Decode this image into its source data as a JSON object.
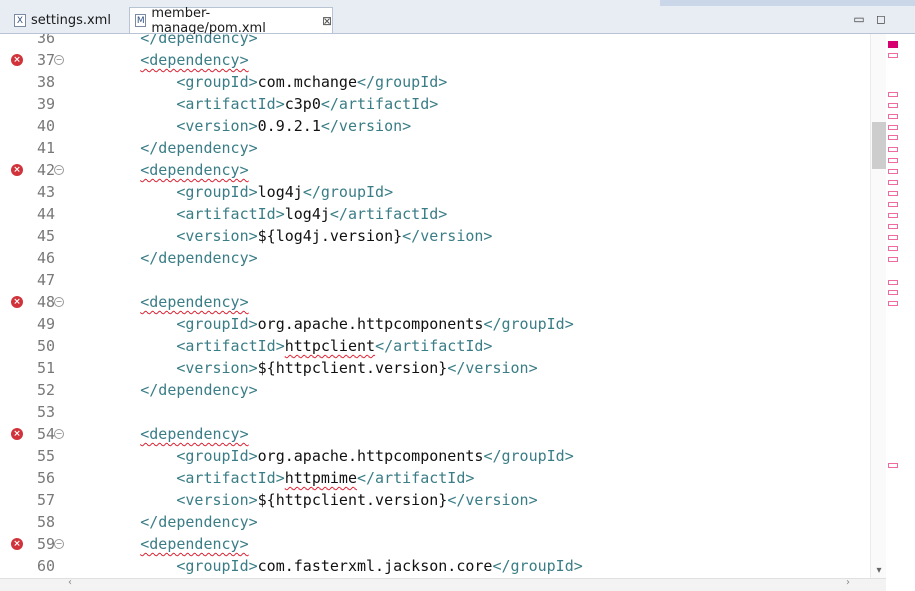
{
  "tabs": [
    {
      "label": "settings.xml",
      "icon": "xml-file-icon",
      "icon_glyph": "X",
      "active": false
    },
    {
      "label": "member-manage/pom.xml",
      "icon": "maven-pom-icon",
      "icon_glyph": "M",
      "active": true,
      "close": "⊠"
    }
  ],
  "window": {
    "minimize": "▭",
    "maximize": "◻"
  },
  "colors": {
    "tag": "#3a7d86",
    "error": "#d0343a",
    "marker": "#ee6aa0",
    "text": "#111111"
  },
  "editor": {
    "lines": [
      {
        "num": "36",
        "indent": "        ",
        "tokens": [
          {
            "t": "t",
            "v": "</dependency>"
          }
        ]
      },
      {
        "num": "37",
        "err": true,
        "fold": true,
        "indent": "        ",
        "tokens": [
          {
            "t": "tw",
            "v": "<dependency>"
          }
        ]
      },
      {
        "num": "38",
        "indent": "            ",
        "tokens": [
          {
            "t": "t",
            "v": "<groupId>"
          },
          {
            "t": "x",
            "v": "com.mchange"
          },
          {
            "t": "t",
            "v": "</groupId>"
          }
        ]
      },
      {
        "num": "39",
        "indent": "            ",
        "tokens": [
          {
            "t": "t",
            "v": "<artifactId>"
          },
          {
            "t": "x",
            "v": "c3p0"
          },
          {
            "t": "t",
            "v": "</artifactId>"
          }
        ]
      },
      {
        "num": "40",
        "indent": "            ",
        "tokens": [
          {
            "t": "t",
            "v": "<version>"
          },
          {
            "t": "x",
            "v": "0.9.2.1"
          },
          {
            "t": "t",
            "v": "</version>"
          }
        ]
      },
      {
        "num": "41",
        "indent": "        ",
        "tokens": [
          {
            "t": "t",
            "v": "</dependency>"
          }
        ]
      },
      {
        "num": "42",
        "err": true,
        "fold": true,
        "indent": "        ",
        "tokens": [
          {
            "t": "tw",
            "v": "<dependency>"
          }
        ]
      },
      {
        "num": "43",
        "indent": "            ",
        "tokens": [
          {
            "t": "t",
            "v": "<groupId>"
          },
          {
            "t": "x",
            "v": "log4j"
          },
          {
            "t": "t",
            "v": "</groupId>"
          }
        ]
      },
      {
        "num": "44",
        "indent": "            ",
        "tokens": [
          {
            "t": "t",
            "v": "<artifactId>"
          },
          {
            "t": "x",
            "v": "log4j"
          },
          {
            "t": "t",
            "v": "</artifactId>"
          }
        ]
      },
      {
        "num": "45",
        "indent": "            ",
        "tokens": [
          {
            "t": "t",
            "v": "<version>"
          },
          {
            "t": "x",
            "v": "${log4j.version}"
          },
          {
            "t": "t",
            "v": "</version>"
          }
        ]
      },
      {
        "num": "46",
        "indent": "        ",
        "tokens": [
          {
            "t": "t",
            "v": "</dependency>"
          }
        ]
      },
      {
        "num": "47",
        "indent": "",
        "tokens": []
      },
      {
        "num": "48",
        "err": true,
        "fold": true,
        "indent": "        ",
        "tokens": [
          {
            "t": "tw",
            "v": "<dependency>"
          }
        ]
      },
      {
        "num": "49",
        "indent": "            ",
        "tokens": [
          {
            "t": "t",
            "v": "<groupId>"
          },
          {
            "t": "x",
            "v": "org.apache.httpcomponents"
          },
          {
            "t": "t",
            "v": "</groupId>"
          }
        ]
      },
      {
        "num": "50",
        "indent": "            ",
        "tokens": [
          {
            "t": "t",
            "v": "<artifactId>"
          },
          {
            "t": "xw",
            "v": "httpclient"
          },
          {
            "t": "t",
            "v": "</artifactId>"
          }
        ]
      },
      {
        "num": "51",
        "indent": "            ",
        "tokens": [
          {
            "t": "t",
            "v": "<version>"
          },
          {
            "t": "x",
            "v": "${httpclient.version}"
          },
          {
            "t": "t",
            "v": "</version>"
          }
        ]
      },
      {
        "num": "52",
        "indent": "        ",
        "tokens": [
          {
            "t": "t",
            "v": "</dependency>"
          }
        ]
      },
      {
        "num": "53",
        "indent": "",
        "tokens": []
      },
      {
        "num": "54",
        "err": true,
        "fold": true,
        "indent": "        ",
        "tokens": [
          {
            "t": "tw",
            "v": "<dependency>"
          }
        ]
      },
      {
        "num": "55",
        "indent": "            ",
        "tokens": [
          {
            "t": "t",
            "v": "<groupId>"
          },
          {
            "t": "x",
            "v": "org.apache.httpcomponents"
          },
          {
            "t": "t",
            "v": "</groupId>"
          }
        ]
      },
      {
        "num": "56",
        "indent": "            ",
        "tokens": [
          {
            "t": "t",
            "v": "<artifactId>"
          },
          {
            "t": "xw",
            "v": "httpmime"
          },
          {
            "t": "t",
            "v": "</artifactId>"
          }
        ]
      },
      {
        "num": "57",
        "indent": "            ",
        "tokens": [
          {
            "t": "t",
            "v": "<version>"
          },
          {
            "t": "x",
            "v": "${httpclient.version}"
          },
          {
            "t": "t",
            "v": "</version>"
          }
        ]
      },
      {
        "num": "58",
        "indent": "        ",
        "tokens": [
          {
            "t": "t",
            "v": "</dependency>"
          }
        ]
      },
      {
        "num": "59",
        "err": true,
        "fold": true,
        "indent": "        ",
        "tokens": [
          {
            "t": "tw",
            "v": "<dependency>"
          }
        ]
      },
      {
        "num": "60",
        "indent": "            ",
        "tokens": [
          {
            "t": "t",
            "v": "<groupId>"
          },
          {
            "t": "x",
            "v": "com.fasterxml.jackson.core"
          },
          {
            "t": "t",
            "v": "</groupId>"
          }
        ]
      }
    ]
  },
  "overview_ruler": {
    "marker_count": 21,
    "top_marker": "error-summary"
  }
}
